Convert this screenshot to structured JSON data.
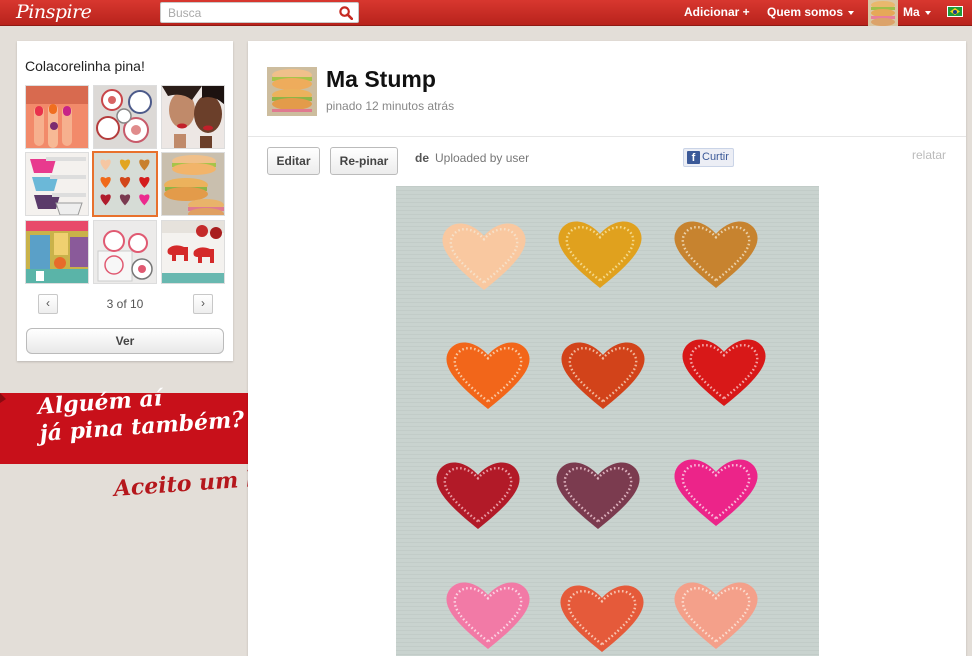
{
  "header": {
    "logo": "Pinspire",
    "search_placeholder": "Busca",
    "add_label": "Adicionar +",
    "about_label": "Quem somos",
    "user_name": "Ma",
    "language_flag": "brazil-flag"
  },
  "board": {
    "title": "Colacorelinha pina!",
    "pager_label": "3 of 10",
    "prev_icon": "chevron-left-icon",
    "next_icon": "chevron-right-icon",
    "view_label": "Ver",
    "thumbnails": [
      "nails",
      "plates",
      "lipstick-ring",
      "teacups",
      "felt-hearts",
      "macarons",
      "craft-room",
      "stamps",
      "elephant-garland"
    ],
    "selected_index": 4
  },
  "overlay": {
    "ribbon_line1": "Alguém aí",
    "ribbon_line2": "já pina também?",
    "help_text": "Aceito um help!"
  },
  "pin": {
    "user": "Ma Stump",
    "time": "pinado 12 minutos atrás",
    "edit_label": "Editar",
    "repin_label": "Re-pinar",
    "source_prefix": "de",
    "source": "Uploaded by user",
    "like_label": "Curtir",
    "report_label": "relatar",
    "image": "felt-hearts-photo"
  },
  "colors": {
    "brand_red": "#c62a22",
    "background": "#e3ded8",
    "ribbon_red": "#c8101a",
    "facebook_blue": "#3b5998"
  }
}
